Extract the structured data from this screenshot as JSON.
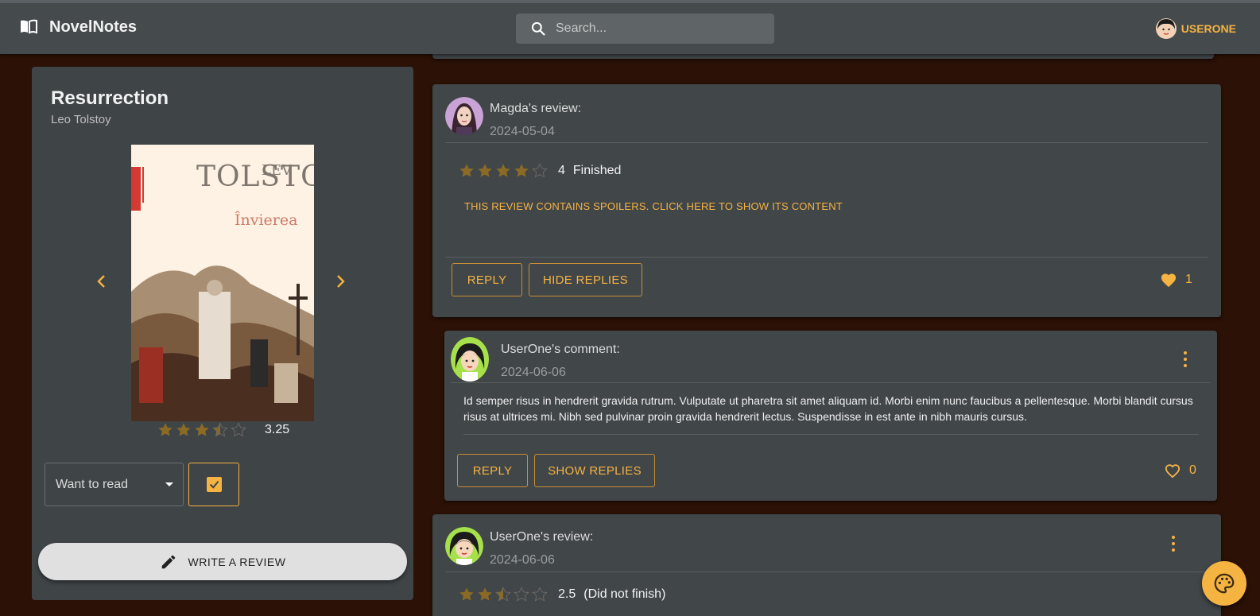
{
  "app": {
    "name": "NovelNotes",
    "search_placeholder": "Search...",
    "user_name": "USERONE"
  },
  "book": {
    "title": "Resurrection",
    "author": "Leo Tolstoy",
    "cover": {
      "author_first": "LEV",
      "author_last": "TOLSTOI",
      "title": "Învierea"
    },
    "average_rating": "3.25",
    "average_stars": 3.25,
    "shelf": "Want to read",
    "shelf_checked": true,
    "write_review_label": "WRITE A REVIEW"
  },
  "feed": [
    {
      "kind": "review",
      "header": "Magda's review:",
      "date": "2024-05-04",
      "stars": 4,
      "rating_text": "4",
      "status": "Finished",
      "spoiler_notice": "THIS REVIEW CONTAINS SPOILERS. CLICK HERE TO SHOW ITS CONTENT",
      "reply_label": "REPLY",
      "replies_toggle_label": "HIDE REPLIES",
      "likes": "1",
      "liked": true
    },
    {
      "kind": "comment",
      "header": "UserOne's comment:",
      "date": "2024-06-06",
      "text": "Id semper risus in hendrerit gravida rutrum. Vulputate ut pharetra sit amet aliquam id. Morbi enim nunc faucibus a pellentesque. Morbi blandit cursus risus at ultrices mi. Nibh sed pulvinar proin gravida hendrerit lectus. Suspendisse in est ante in nibh mauris cursus.",
      "reply_label": "REPLY",
      "replies_toggle_label": "SHOW REPLIES",
      "likes": "0",
      "liked": false
    },
    {
      "kind": "review",
      "header": "UserOne's review:",
      "date": "2024-06-06",
      "stars": 2.5,
      "rating_text": "2.5",
      "status": "(Did not finish)"
    }
  ],
  "colors": {
    "accent": "#f5b342",
    "page_background": "#2b1106",
    "card_background": "#414649",
    "appbar_background": "#454a4d",
    "star_filled": "#8a6a25"
  },
  "icons": {
    "brand": "open-book-icon",
    "search": "search-icon",
    "prev": "chevron-left-icon",
    "next": "chevron-right-icon",
    "write": "pencil-icon",
    "like": "heart-icon",
    "more": "kebab-menu-icon",
    "theme": "palette-icon"
  }
}
